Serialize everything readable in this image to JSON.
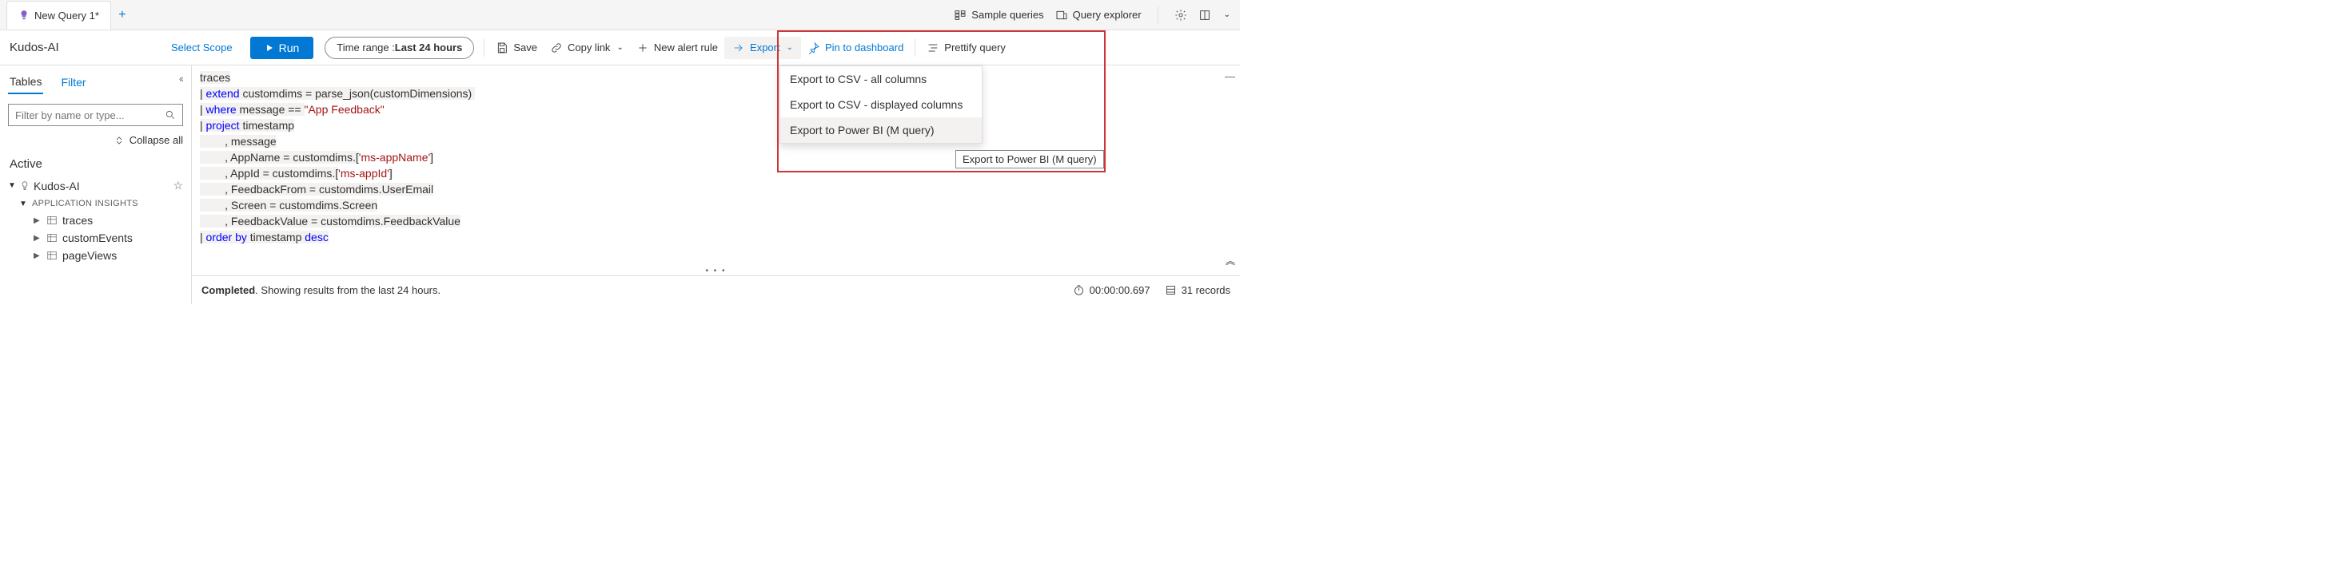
{
  "tab": {
    "title": "New Query 1*"
  },
  "header_right": {
    "sample": "Sample queries",
    "explorer": "Query explorer"
  },
  "toolbar": {
    "scope_name": "Kudos-AI",
    "select_scope": "Select Scope",
    "run": "Run",
    "time_label": "Time range : ",
    "time_value": "Last 24 hours",
    "save": "Save",
    "copy": "Copy link",
    "new_alert": "New alert rule",
    "export": "Export",
    "pin": "Pin to dashboard",
    "prettify": "Prettify query"
  },
  "sidebar": {
    "tab_tables": "Tables",
    "tab_filter": "Filter",
    "search_placeholder": "Filter by name or type...",
    "collapse_all": "Collapse all",
    "active_label": "Active",
    "root": "Kudos-AI",
    "group": "APPLICATION INSIGHTS",
    "leaves": [
      "traces",
      "customEvents",
      "pageViews"
    ]
  },
  "code": {
    "l1": "traces",
    "l2a": "| ",
    "l2b": "extend",
    "l2c": " customdims = parse_json(customDimensions) ",
    "l3a": "| ",
    "l3b": "where",
    "l3c": " message == ",
    "l3d": "\"App Feedback\"",
    "l4a": "| ",
    "l4b": "project",
    "l4c": " timestamp",
    "l5": "        , message",
    "l6a": "        , AppName = customdims.[",
    "l6b": "'ms-appName'",
    "l6c": "]",
    "l7a": "        , AppId = customdims.[",
    "l7b": "'ms-appId'",
    "l7c": "]",
    "l8": "        , FeedbackFrom = customdims.UserEmail",
    "l9": "        , Screen = customdims.Screen",
    "l10": "        , FeedbackValue = customdims.FeedbackValue",
    "l11a": "| ",
    "l11b": "order by",
    "l11c": " timestamp ",
    "l11d": "desc"
  },
  "export_menu": {
    "items": [
      "Export to CSV - all columns",
      "Export to CSV - displayed columns",
      "Export to Power BI (M query)"
    ],
    "tooltip": "Export to Power BI (M query)"
  },
  "status": {
    "completed": "Completed",
    "text": ". Showing results from the last 24 hours.",
    "duration": "00:00:00.697",
    "records": "31 records"
  }
}
